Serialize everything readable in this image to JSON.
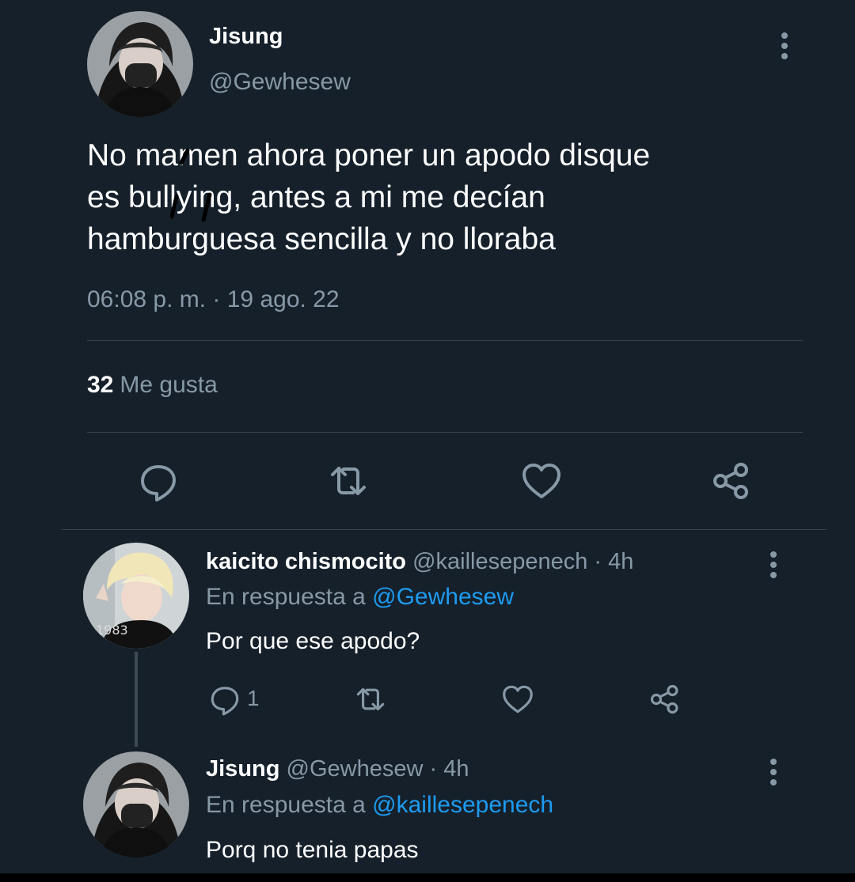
{
  "main_tweet": {
    "author_name": "Jisung",
    "author_handle": "@Gewhesew",
    "text": "No mamen ahora poner un apodo disque\nes bullying, antes a mi me decían\nhamburguesa sencilla y no lloraba",
    "timestamp": "06:08 p. m. · 19 ago. 22",
    "likes_count": "32",
    "likes_label": "Me gusta",
    "icons": [
      "more-vertical-icon",
      "reply-icon",
      "retweet-icon",
      "heart-icon",
      "share-icon"
    ]
  },
  "replies": [
    {
      "author_name": "kaicito chismocito",
      "meta": "@kaillesepenech · 4h",
      "reply_prefix": "En respuesta a",
      "reply_mention": "@Gewhesew",
      "text": "Por que ese apodo?",
      "reply_count": "1"
    },
    {
      "author_name": "Jisung",
      "meta": "@Gewhesew · 4h",
      "reply_prefix": "En respuesta a",
      "reply_mention": "@kaillesepenech",
      "text": "Porq no tenia papas"
    }
  ],
  "colors": {
    "background": "#15202b",
    "secondary_text": "#8899a6",
    "link": "#1d9bf0",
    "divider": "#38444d"
  }
}
